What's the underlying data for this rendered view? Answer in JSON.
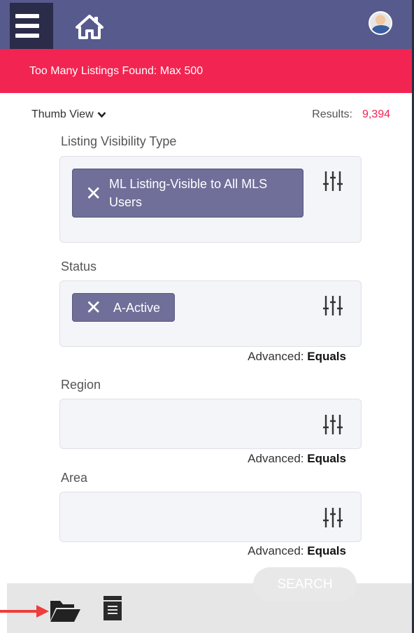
{
  "header": {
    "menu_icon": "hamburger-menu-icon",
    "home_icon": "home-icon",
    "avatar_icon": "user-avatar"
  },
  "alert": {
    "message": "Too Many Listings Found: Max 500"
  },
  "toolbar": {
    "view_label": "Thumb View",
    "results_label": "Results:",
    "results_count": "9,394"
  },
  "fields": {
    "visibility": {
      "label": "Listing Visibility Type",
      "tag_line1": "ML Listing-Visible to All MLS",
      "tag_line2": "Users"
    },
    "status": {
      "label": "Status",
      "tag": "A-Active",
      "advanced_label": "Advanced:",
      "advanced_value": "Equals"
    },
    "region": {
      "label": "Region",
      "advanced_label": "Advanced:",
      "advanced_value": "Equals"
    },
    "area": {
      "label": "Area",
      "advanced_label": "Advanced:",
      "advanced_value": "Equals"
    }
  },
  "footer": {
    "search_label": "SEARCH",
    "folder_icon": "open-folder-icon",
    "list_icon": "document-list-icon"
  },
  "colors": {
    "header_bg": "#575a8c",
    "alert_bg": "#f22451",
    "tag_bg": "#6f6f99",
    "accent": "#f22451"
  }
}
